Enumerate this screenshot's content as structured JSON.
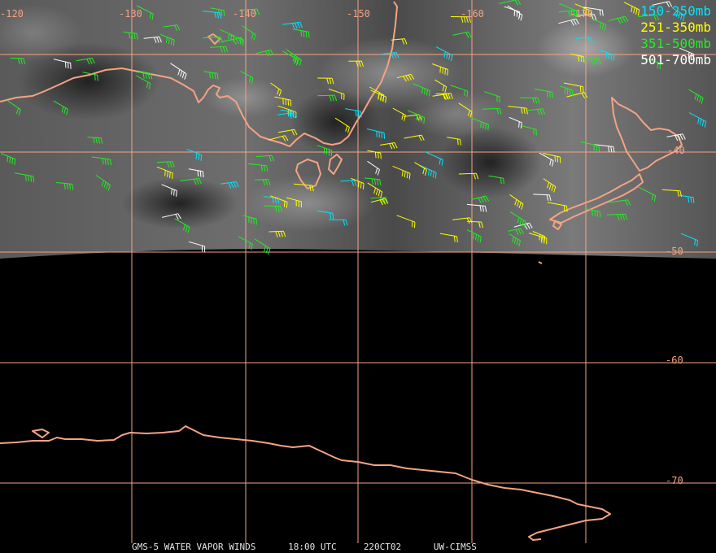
{
  "map": {
    "longitude_labels": [
      "-120",
      "-130",
      "-140",
      "-150",
      "-160",
      "-170"
    ],
    "latitude_labels": [
      "-40",
      "-50",
      "-60",
      "-70"
    ],
    "gridline_color": "#f4a383",
    "coastline_color": "#f4a383",
    "image_background": "#000000"
  },
  "legend": [
    {
      "label": "150-250mb",
      "color": "#00e5ff"
    },
    {
      "label": "251-350mb",
      "color": "#ffff00"
    },
    {
      "label": "351-500mb",
      "color": "#22ee22"
    },
    {
      "label": "501-700mb",
      "color": "#ffffff"
    }
  ],
  "footer": {
    "satellite": "GMS-5 WATER VAPOR WINDS",
    "time": "18:00 UTC",
    "date": "220CT02",
    "source": "UW-CIMSS"
  }
}
